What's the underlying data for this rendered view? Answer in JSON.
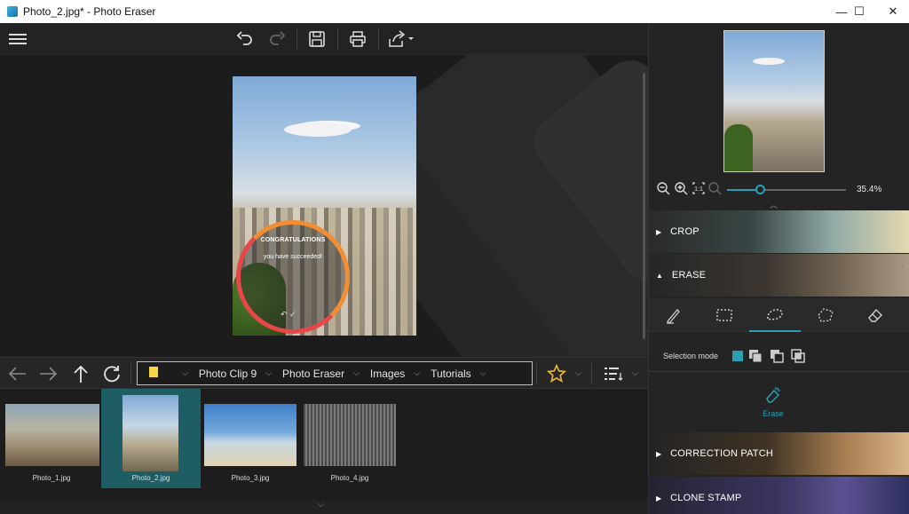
{
  "window": {
    "title": "Photo_2.jpg* - Photo Eraser",
    "minimize": "—",
    "maximize": "☐",
    "close": "✕"
  },
  "colors": {
    "accent": "#2a9fb1",
    "selected_thumb": "#1f5d64",
    "ring_red": "#e8474a",
    "ring_orange": "#f38d34",
    "star": "#e7b53a"
  },
  "toolbar": {
    "icons": [
      "menu-icon",
      "undo-icon",
      "redo-icon",
      "save-icon",
      "print-icon",
      "share-icon"
    ]
  },
  "canvas": {
    "overlay_title": "CONGRATULATIONS",
    "overlay_subtitle": "you have succeeded!",
    "overlay_icons": "↶ ✓"
  },
  "nav": {
    "path": [
      {
        "label": "Photo Clip 9"
      },
      {
        "label": "Photo Eraser"
      },
      {
        "label": "Images"
      },
      {
        "label": "Tutorials"
      }
    ]
  },
  "thumbnails": [
    {
      "label": "Photo_1.jpg",
      "selected": false
    },
    {
      "label": "Photo_2.jpg",
      "selected": true
    },
    {
      "label": "Photo_3.jpg",
      "selected": false
    },
    {
      "label": "Photo_4.jpg",
      "selected": false
    }
  ],
  "panel": {
    "zoom_value": "35.4%",
    "sections": {
      "crop": "CROP",
      "erase": "ERASE",
      "correction_patch": "CORRECTION PATCH",
      "clone_stamp": "CLONE STAMP"
    },
    "selection_mode_label": "Selection mode",
    "erase_button": "Erase"
  }
}
